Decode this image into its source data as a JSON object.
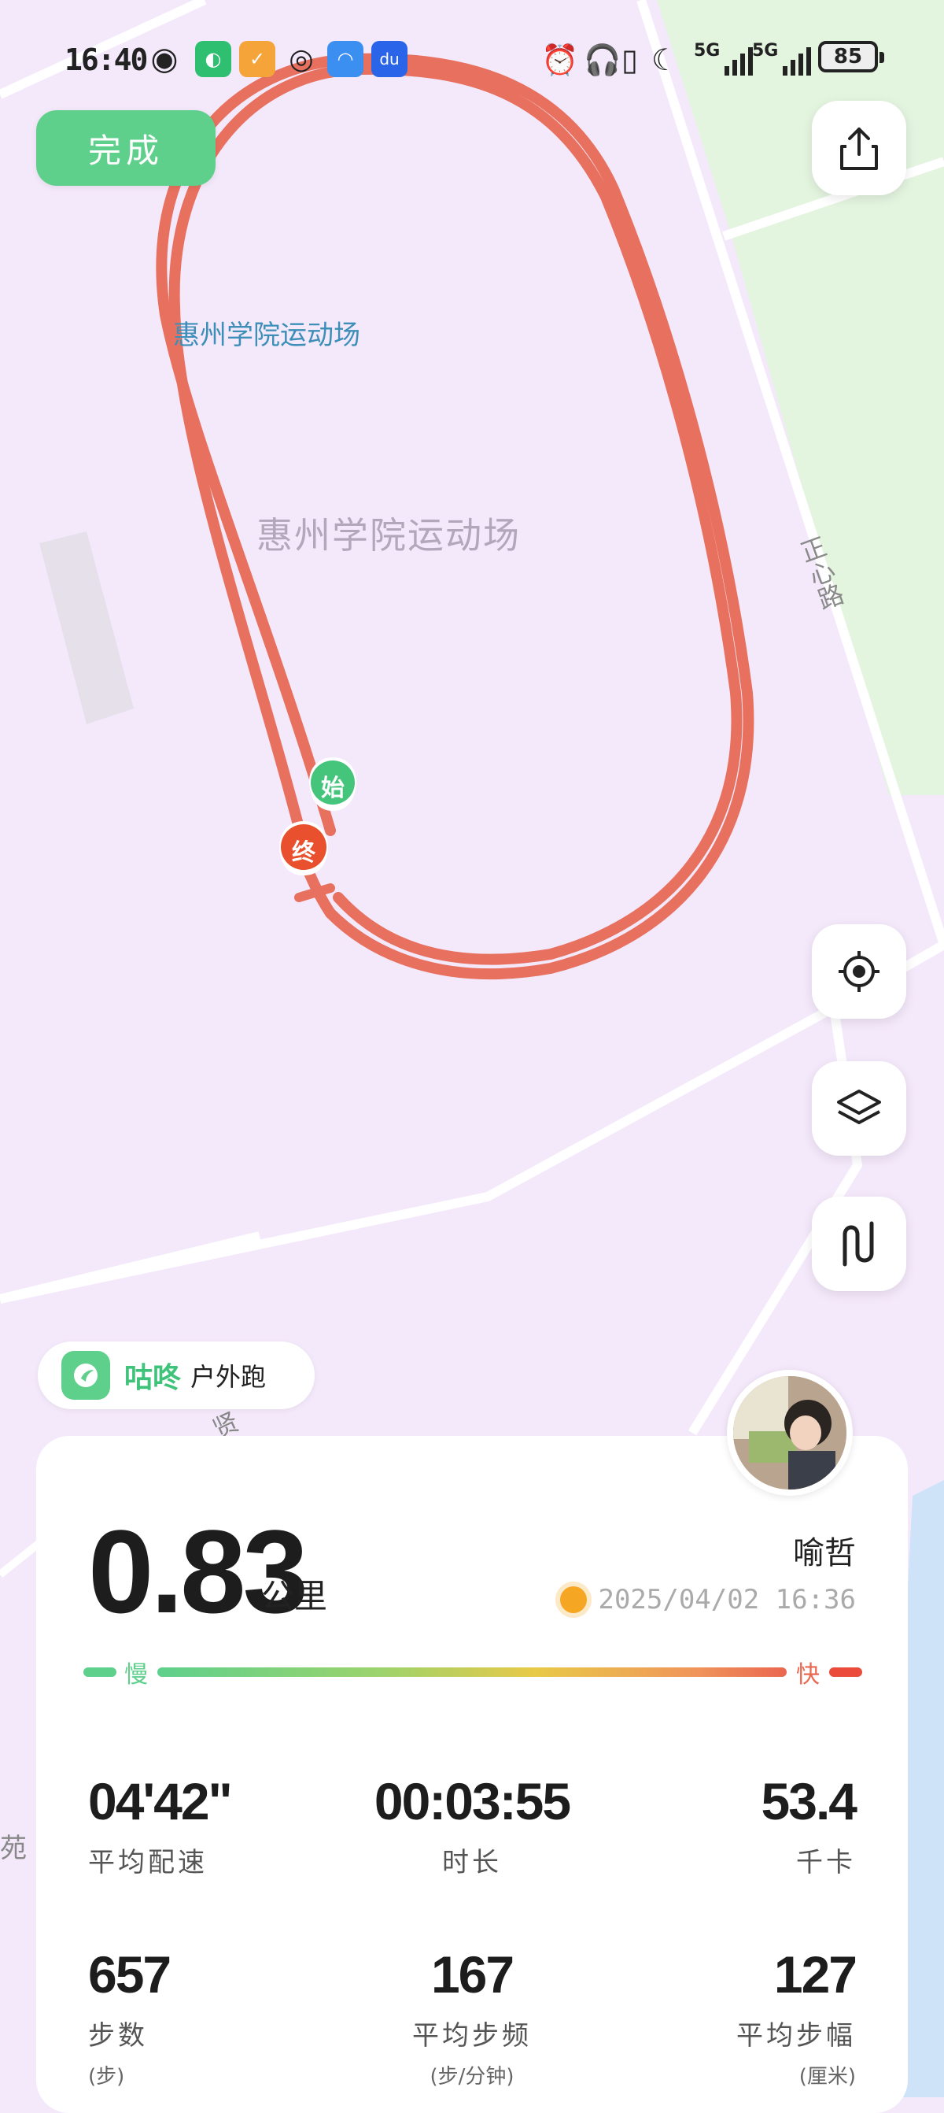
{
  "status_bar": {
    "time": "16:40",
    "signal1_label": "5G",
    "signal2_label": "5G",
    "battery": "85",
    "left_icons": [
      "eye-icon",
      "gudong-app-icon",
      "check-app-icon",
      "wechat-icon",
      "browser-icon",
      "baidu-icon"
    ],
    "right_icons": [
      "alarm-icon",
      "headphones-icon",
      "battery-saver-icon",
      "moon-icon"
    ]
  },
  "header": {
    "done_label": "完成",
    "share_icon": "share-icon"
  },
  "map": {
    "track_label_top": "惠州学院运动场",
    "track_label_center": "惠州学院运动场",
    "road_label": "正心路",
    "start_marker": "始",
    "end_marker": "终",
    "side_label": "苑",
    "road_label_lower": "贤"
  },
  "controls": {
    "locate_icon": "locate-icon",
    "layers_icon": "layers-icon",
    "route_icon": "route-icon"
  },
  "brand": {
    "name": "咕咚",
    "activity": "户外跑"
  },
  "summary": {
    "distance": "0.83",
    "distance_unit": "公里",
    "user_name": "喻哲",
    "datetime": "2025/04/02 16:36",
    "pace_slow": "慢",
    "pace_fast": "快"
  },
  "stats": [
    {
      "value": "04'42\"",
      "label": "平均配速",
      "unit": ""
    },
    {
      "value": "00:03:55",
      "label": "时长",
      "unit": ""
    },
    {
      "value": "53.4",
      "label": "千卡",
      "unit": ""
    },
    {
      "value": "657",
      "label": "步数",
      "unit": "(步)"
    },
    {
      "value": "167",
      "label": "平均步频",
      "unit": "(步/分钟)"
    },
    {
      "value": "127",
      "label": "平均步幅",
      "unit": "(厘米)"
    }
  ],
  "colors": {
    "accent_green": "#5ed08c",
    "track_red": "#e8705e",
    "map_bg": "#f4e9fb",
    "map_green": "#e3f4df"
  }
}
